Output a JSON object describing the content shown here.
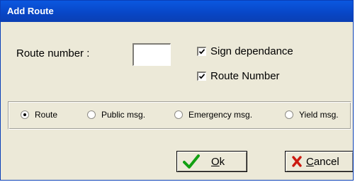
{
  "window": {
    "title": "Add Route"
  },
  "form": {
    "route_number_label": "Route number :",
    "route_number_value": ""
  },
  "checkboxes": [
    {
      "label": "Sign dependance",
      "checked": true
    },
    {
      "label": "Route Number",
      "checked": true
    }
  ],
  "message_type": {
    "options": [
      {
        "label": "Route",
        "selected": true
      },
      {
        "label": "Public msg.",
        "selected": false
      },
      {
        "label": "Emergency msg.",
        "selected": false
      },
      {
        "label": "Yield msg.",
        "selected": false
      }
    ]
  },
  "buttons": {
    "ok": {
      "mnemonic": "O",
      "rest": "k",
      "icon": "green-check-icon"
    },
    "cancel": {
      "mnemonic": "C",
      "rest": "ancel",
      "icon": "red-x-icon"
    }
  },
  "colors": {
    "titlebar": "#0847c8",
    "dialog_bg": "#ece9d8",
    "ok_icon": "#12a012",
    "cancel_icon": "#cc1a10"
  }
}
